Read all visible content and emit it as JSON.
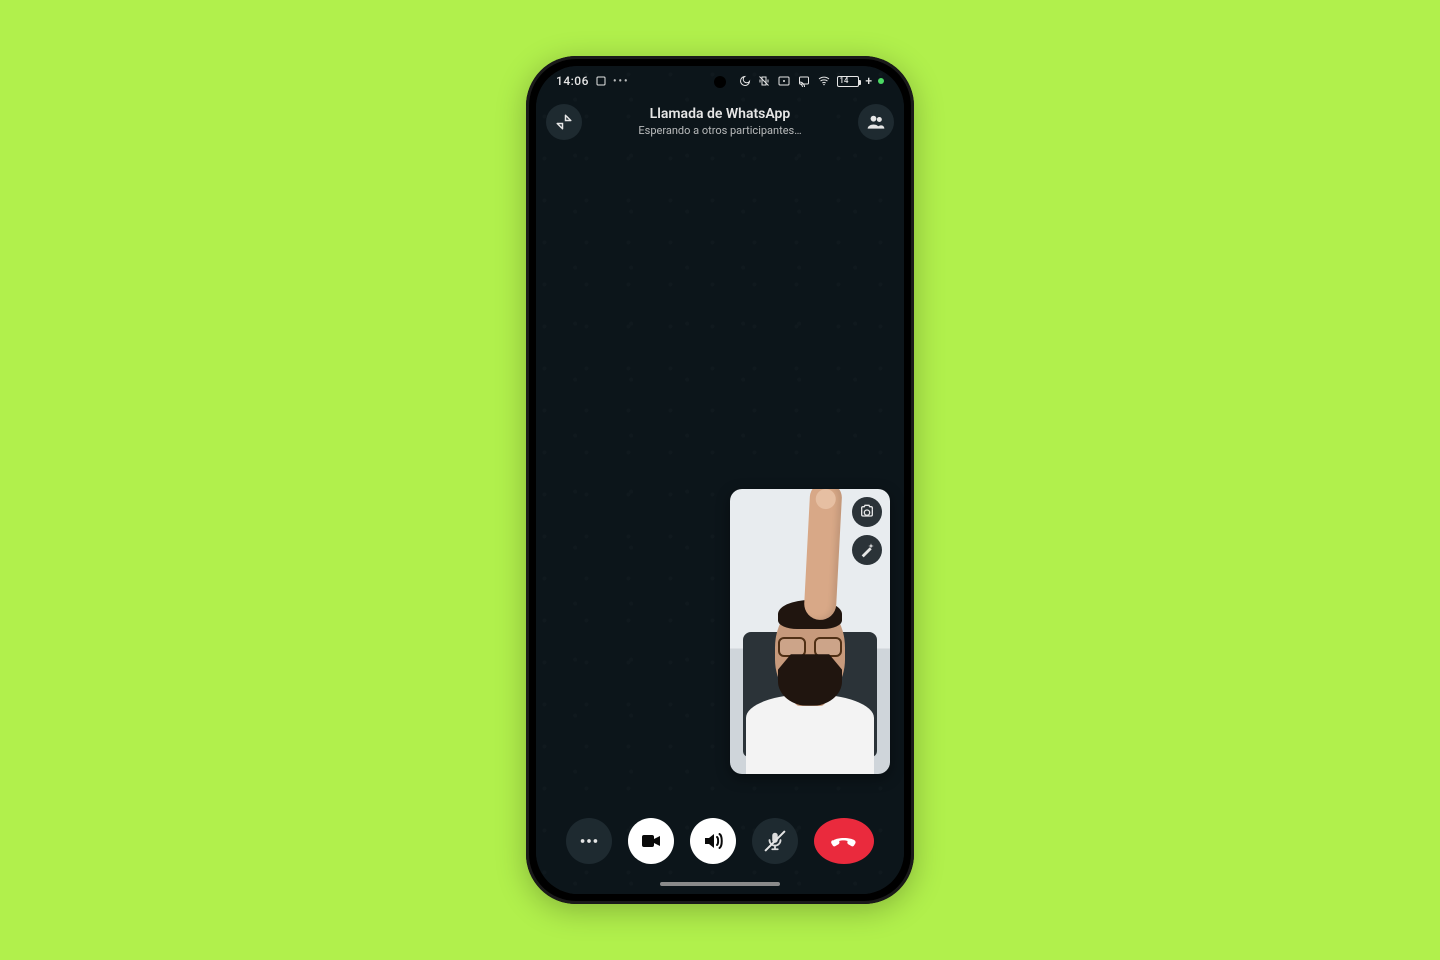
{
  "statusbar": {
    "time": "14:06",
    "charging_indicator": "+",
    "battery_text": "14",
    "icons": {
      "app_open": "app-open-icon",
      "ellipsis": "ellipsis-icon",
      "dnd": "moon-icon",
      "vibrate": "vibrate-off-icon",
      "vowifi": "vowifi-icon",
      "cast": "cast-icon",
      "wifi": "wifi-icon"
    }
  },
  "appbar": {
    "minimize_icon": "minimize-icon",
    "title": "Llamada de WhatsApp",
    "subtitle": "Esperando a otros participantes…",
    "participants_icon": "participants-icon"
  },
  "pip": {
    "description": "self camera preview",
    "switch_camera_icon": "switch-camera-icon",
    "effects_icon": "magic-wand-icon"
  },
  "actions": {
    "more_icon": "more-horizontal-icon",
    "video_icon": "video-icon",
    "speaker_icon": "speaker-icon",
    "mic_muted_icon": "mic-muted-icon",
    "hangup_icon": "phone-hangup-icon"
  },
  "colors": {
    "page_bg": "#b1f04c",
    "screen_bg": "#0c151a",
    "chip_bg": "#1e2a30",
    "hangup": "#ea2a3d"
  }
}
